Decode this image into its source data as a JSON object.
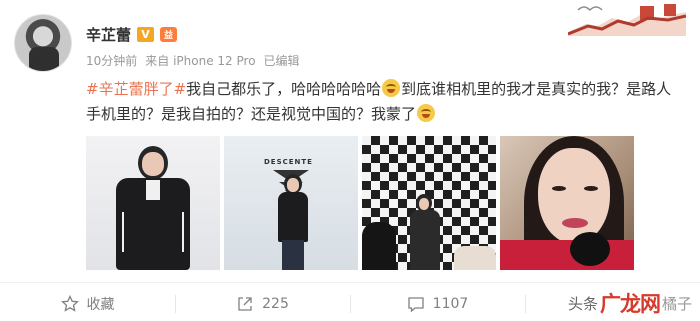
{
  "post": {
    "author": {
      "name": "辛芷蕾",
      "badges": [
        "V",
        "益"
      ]
    },
    "meta": {
      "time": "10分钟前",
      "source": "来自 iPhone 12 Pro",
      "status": "已编辑"
    },
    "text": {
      "topic": "#辛芷蕾胖了#",
      "segment1": "我自己都乐了，哈哈哈哈哈哈",
      "segment2": "到底谁相机里的我才是真实的我？是路人手机里的？是我自拍的？还是视觉中国的？我蒙了",
      "emoji": "laughing-tears-emoji"
    },
    "images": [
      {
        "name": "photo-black-jacket"
      },
      {
        "name": "photo-descente-event",
        "logo_text": "DESCENTE"
      },
      {
        "name": "photo-checkered-backdrop"
      },
      {
        "name": "photo-selfie"
      }
    ]
  },
  "actions": {
    "favorite_label": "收藏",
    "repost_count": "225",
    "comment_count": "1107"
  },
  "watermark": {
    "prefix": "头条",
    "brand": "广龙网",
    "suffix": "橘子"
  },
  "colors": {
    "topic": "#eb7350",
    "text": "#333333",
    "meta": "#999999",
    "action": "#808080"
  }
}
